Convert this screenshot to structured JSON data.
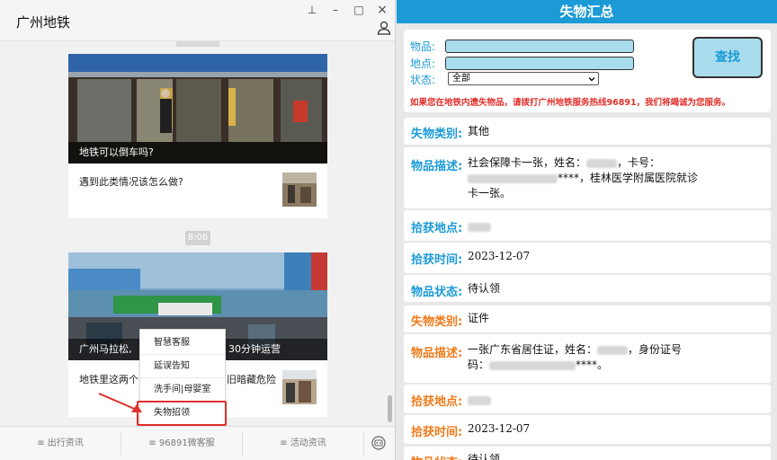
{
  "left": {
    "app_title": "广州地铁",
    "window_buttons": {
      "pin": "⊥",
      "minimize": "–",
      "maximize": "□",
      "close": "×"
    },
    "card1": {
      "caption": "地铁可以倒车吗?",
      "subtitle": "遇到此类情况该怎么做?"
    },
    "time": "8:06",
    "card2": {
      "caption": "广州马拉松,",
      "caption_right": "30分钟运营",
      "subtitle_left": "地铁里这两个",
      "subtitle_right": "旧暗藏危险"
    },
    "popup_menu": [
      "智慧客服",
      "延误告知",
      "洗手间|母婴室",
      "失物招领"
    ],
    "bottom_menu": [
      "≡ 出行资讯",
      "≡ 96891微客服",
      "≡ 活动资讯"
    ]
  },
  "right": {
    "header": "失物汇总",
    "search": {
      "item_label": "物品:",
      "place_label": "地点:",
      "status_label": "状态:",
      "status_value": "全部",
      "button": "查找",
      "notice": "如果您在地铁内遗失物品，请拨打广州地铁服务热线96891，我们将竭诚为您服务。"
    },
    "record1": {
      "type_label": "失物类别:",
      "type_value": "其他",
      "desc_label": "物品描述:",
      "desc_l1a": "社会保障卡一张，姓名：",
      "desc_l1b": "，卡号：",
      "desc_l2": "****，桂林医学附属医院就诊",
      "desc_l3": "卡一张。",
      "place_label": "拾获地点:",
      "time_label": "拾获时间:",
      "time_value": "2023-12-07",
      "status_label": "物品状态:",
      "status_value": "待认领"
    },
    "record2": {
      "type_label": "失物类别:",
      "type_value": "证件",
      "desc_label": "物品描述:",
      "desc_l1a": "一张广东省居住证，姓名：",
      "desc_l1b": "，身份证号",
      "desc_l2a": "码：",
      "desc_l2b": "****。",
      "place_label": "拾获地点:",
      "time_label": "拾获时间:",
      "time_value": "2023-12-07",
      "status_label": "物品状态:",
      "status_value": "待认领"
    },
    "colors": {
      "blue": "#1b9ad6",
      "orange": "#f07a1a",
      "red": "#e0302a",
      "input": "#a9dcec"
    }
  }
}
